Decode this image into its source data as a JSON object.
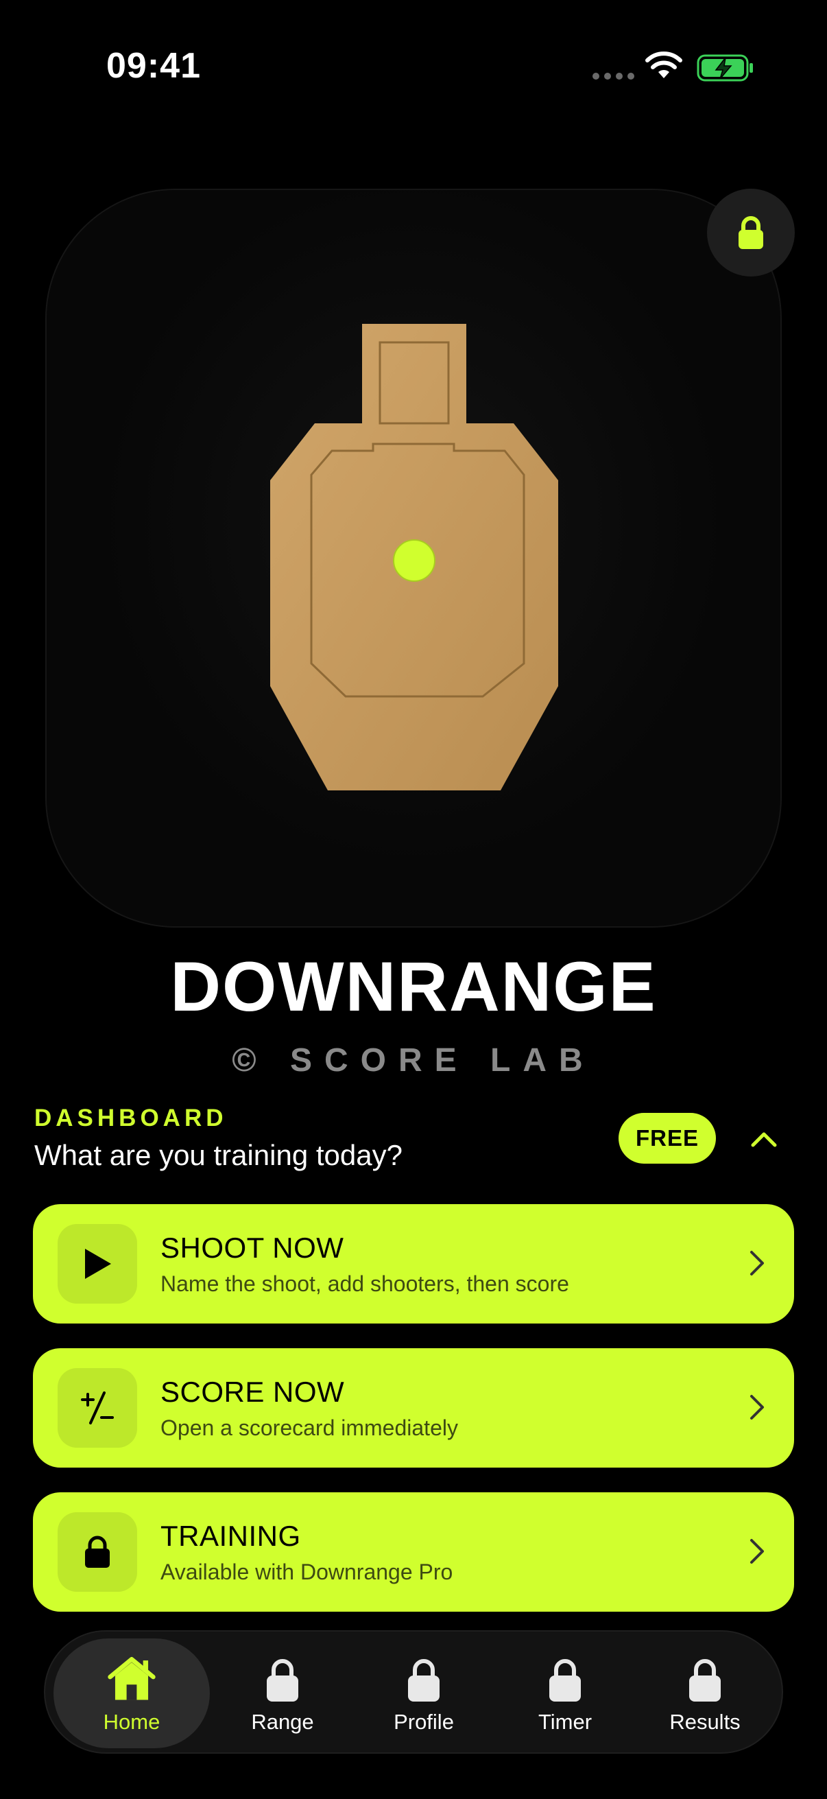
{
  "status_bar": {
    "time": "09:41"
  },
  "hero": {
    "lock_icon": "lock-icon",
    "image": "silhouette-target"
  },
  "app": {
    "title": "DOWNRANGE",
    "subtitle": "© SCORE LAB"
  },
  "dashboard": {
    "kicker": "DASHBOARD",
    "question": "What are you training today?",
    "badge": "FREE",
    "collapse_icon": "chevron-up-icon"
  },
  "cards": [
    {
      "title": "SHOOT NOW",
      "subtitle": "Name the shoot, add shooters, then score",
      "icon": "play-icon"
    },
    {
      "title": "SCORE NOW",
      "subtitle": "Open a scorecard immediately",
      "icon": "plus-minus-icon"
    },
    {
      "title": "TRAINING",
      "subtitle": "Available with Downrange Pro",
      "icon": "lock-icon"
    }
  ],
  "tabs": [
    {
      "label": "Home",
      "icon": "home-icon",
      "active": true
    },
    {
      "label": "Range",
      "icon": "lock-icon"
    },
    {
      "label": "Profile",
      "icon": "lock-icon"
    },
    {
      "label": "Timer",
      "icon": "lock-icon"
    },
    {
      "label": "Results",
      "icon": "lock-icon"
    }
  ],
  "colors": {
    "accent": "#d0ff2e",
    "background": "#000000",
    "target": "#c69a5e"
  }
}
